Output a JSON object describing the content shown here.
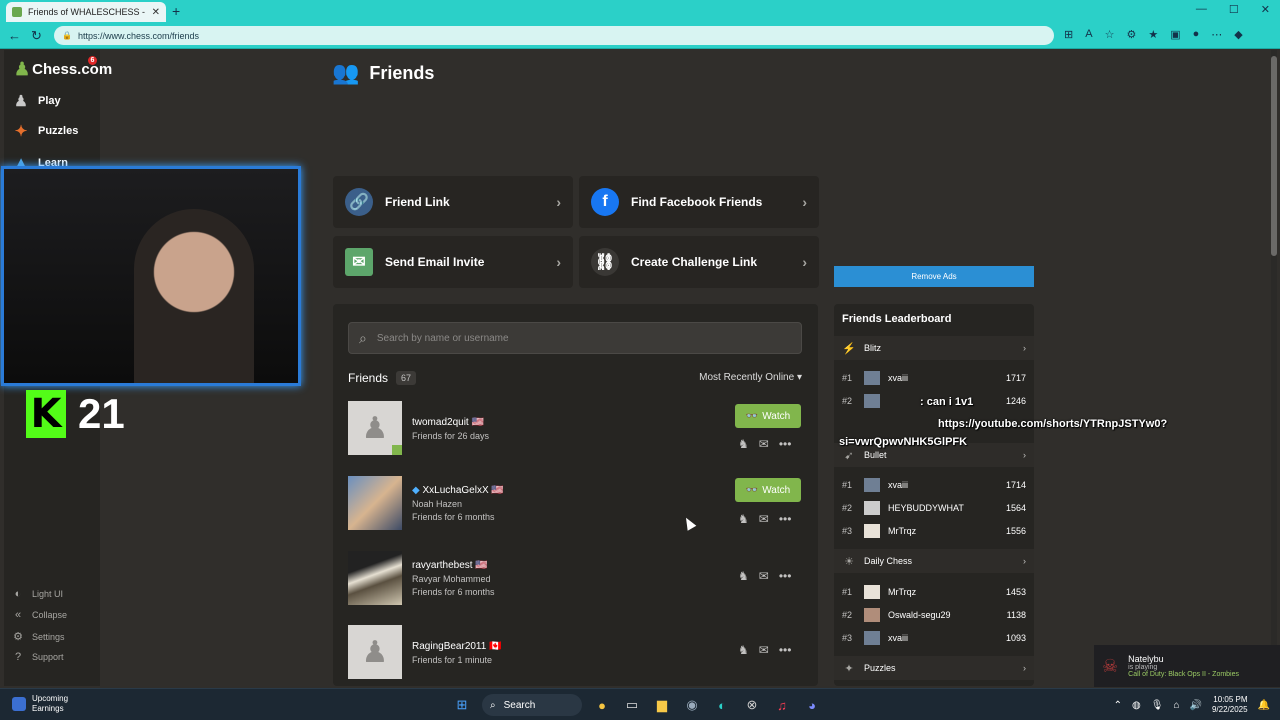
{
  "browser": {
    "tab_title": "Friends of WHALESCHESS - Chess",
    "tab_close": "✕",
    "new_tab": "+",
    "url": "https://www.chess.com/friends",
    "window_controls": [
      "—",
      "☐",
      "✕"
    ]
  },
  "sidebar": {
    "logo": "Chess.com",
    "logo_badge": "6",
    "items": [
      {
        "label": "Play",
        "icon": "pawn-icon"
      },
      {
        "label": "Puzzles",
        "icon": "puzzle-icon"
      },
      {
        "label": "Learn",
        "icon": "learn-icon"
      }
    ],
    "bottom": [
      {
        "label": "Light UI",
        "icon": "theme-icon"
      },
      {
        "label": "Collapse",
        "icon": "collapse-icon"
      },
      {
        "label": "Settings",
        "icon": "gear-icon"
      },
      {
        "label": "Support",
        "icon": "help-icon"
      }
    ]
  },
  "stream": {
    "kick_letter": "K",
    "viewer_count": "21"
  },
  "page": {
    "title": "Friends"
  },
  "actions": [
    {
      "label": "Friend Link",
      "icon": "friend-link-icon"
    },
    {
      "label": "Find Facebook Friends",
      "icon": "facebook-icon"
    },
    {
      "label": "Send Email Invite",
      "icon": "email-icon"
    },
    {
      "label": "Create Challenge Link",
      "icon": "challenge-link-icon"
    }
  ],
  "friends_panel": {
    "search_placeholder": "Search by name or username",
    "header": "Friends",
    "count": "67",
    "sort": "Most Recently Online",
    "watch_label": "Watch",
    "friends": [
      {
        "username": "twomad2quit",
        "flag": "🇺🇸",
        "real_name": "",
        "since": "Friends for 26 days",
        "watch": true
      },
      {
        "username": "XxLuchaGelxX",
        "flag": "🇺🇸",
        "real_name": "Noah Hazen",
        "since": "Friends for 6 months",
        "watch": true
      },
      {
        "username": "ravyarthebest",
        "flag": "🇺🇸",
        "real_name": "Ravyar Mohammed",
        "since": "Friends for 6 months",
        "watch": false
      },
      {
        "username": "RagingBear2011",
        "flag": "🇨🇦",
        "real_name": "",
        "since": "Friends for 1 minute",
        "watch": false
      }
    ]
  },
  "remove_ads": "Remove Ads",
  "leaderboard": {
    "title": "Friends Leaderboard",
    "categories": [
      {
        "name": "Blitz",
        "icon": "blitz-icon",
        "rows": [
          {
            "rank": "#1",
            "name": "xvaiii",
            "score": "1717"
          },
          {
            "rank": "#2",
            "name": "",
            "score": "1246"
          }
        ]
      },
      {
        "name": "Bullet",
        "icon": "bullet-icon",
        "rows": [
          {
            "rank": "#1",
            "name": "xvaiii",
            "score": "1714"
          },
          {
            "rank": "#2",
            "name": "HEYBUDDYWHAT",
            "score": "1564"
          },
          {
            "rank": "#3",
            "name": "MrTrqz",
            "score": "1556"
          }
        ]
      },
      {
        "name": "Daily Chess",
        "icon": "daily-icon",
        "rows": [
          {
            "rank": "#1",
            "name": "MrTrqz",
            "score": "1453"
          },
          {
            "rank": "#2",
            "name": "Oswald-segu29",
            "score": "1138"
          },
          {
            "rank": "#3",
            "name": "xvaiii",
            "score": "1093"
          }
        ]
      },
      {
        "name": "Puzzles",
        "icon": "puzzles-icon",
        "rows": []
      }
    ]
  },
  "chat_overlay": {
    "line1": ": can i 1v1",
    "line2": "https://youtube.com/shorts/YTRnpJSTYw0?",
    "line3": "si=vwrQpwvNHK5GlPFK"
  },
  "notification": {
    "user": "Natelybu",
    "status": "is playing",
    "game": "Call of Duty: Black Ops II - Zombies"
  },
  "taskbar": {
    "weather_title": "Upcoming",
    "weather_sub": "Earnings",
    "search": "Search",
    "time": "10:05 PM",
    "date": "9/22/2025"
  }
}
